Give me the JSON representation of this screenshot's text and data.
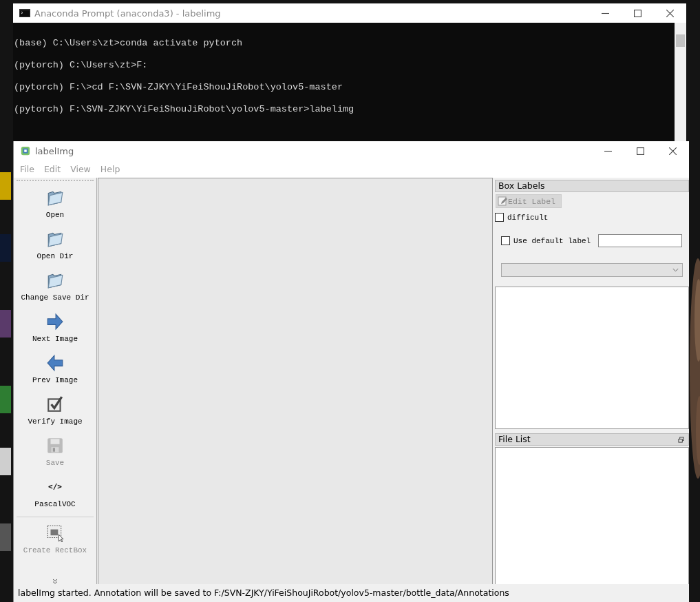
{
  "terminal": {
    "title": "Anaconda Prompt (anaconda3) - labelimg",
    "lines": [
      "(base) C:\\Users\\zt>conda activate pytorch",
      "(pytorch) C:\\Users\\zt>F:",
      "(pytorch) F:\\>cd F:\\SVN-ZJKY\\YiFeiShouJiRobot\\yolov5-master",
      "(pytorch) F:\\SVN-ZJKY\\YiFeiShouJiRobot\\yolov5-master>labelimg"
    ]
  },
  "app": {
    "title": "labelImg",
    "menus": [
      "File",
      "Edit",
      "View",
      "Help"
    ],
    "tools": [
      {
        "kind": "folder",
        "label": "Open",
        "disabled": false
      },
      {
        "kind": "folder",
        "label": "Open Dir",
        "disabled": false
      },
      {
        "kind": "folder",
        "label": "Change Save Dir",
        "disabled": false
      },
      {
        "kind": "next",
        "label": "Next Image",
        "disabled": false
      },
      {
        "kind": "prev",
        "label": "Prev Image",
        "disabled": false
      },
      {
        "kind": "verify",
        "label": "Verify Image",
        "disabled": false
      },
      {
        "kind": "save",
        "label": "Save",
        "disabled": true
      },
      {
        "kind": "format",
        "glyph": "</>",
        "label": "PascalVOC",
        "disabled": false
      },
      {
        "kind": "separator"
      },
      {
        "kind": "rectbox",
        "label": "Create RectBox",
        "disabled": true
      }
    ],
    "box_labels": {
      "title": "Box Labels",
      "edit_button": {
        "label": "Edit Label",
        "disabled": true
      },
      "difficult": {
        "label": "difficult",
        "checked": false
      },
      "use_default": {
        "label": "Use default label",
        "checked": false
      }
    },
    "file_list": {
      "title": "File List"
    },
    "status": "labelImg started. Annotation will be saved to F:/SVN-ZJKY/YiFeiShouJiRobot/yolov5-master/bottle_data/Annotations"
  }
}
